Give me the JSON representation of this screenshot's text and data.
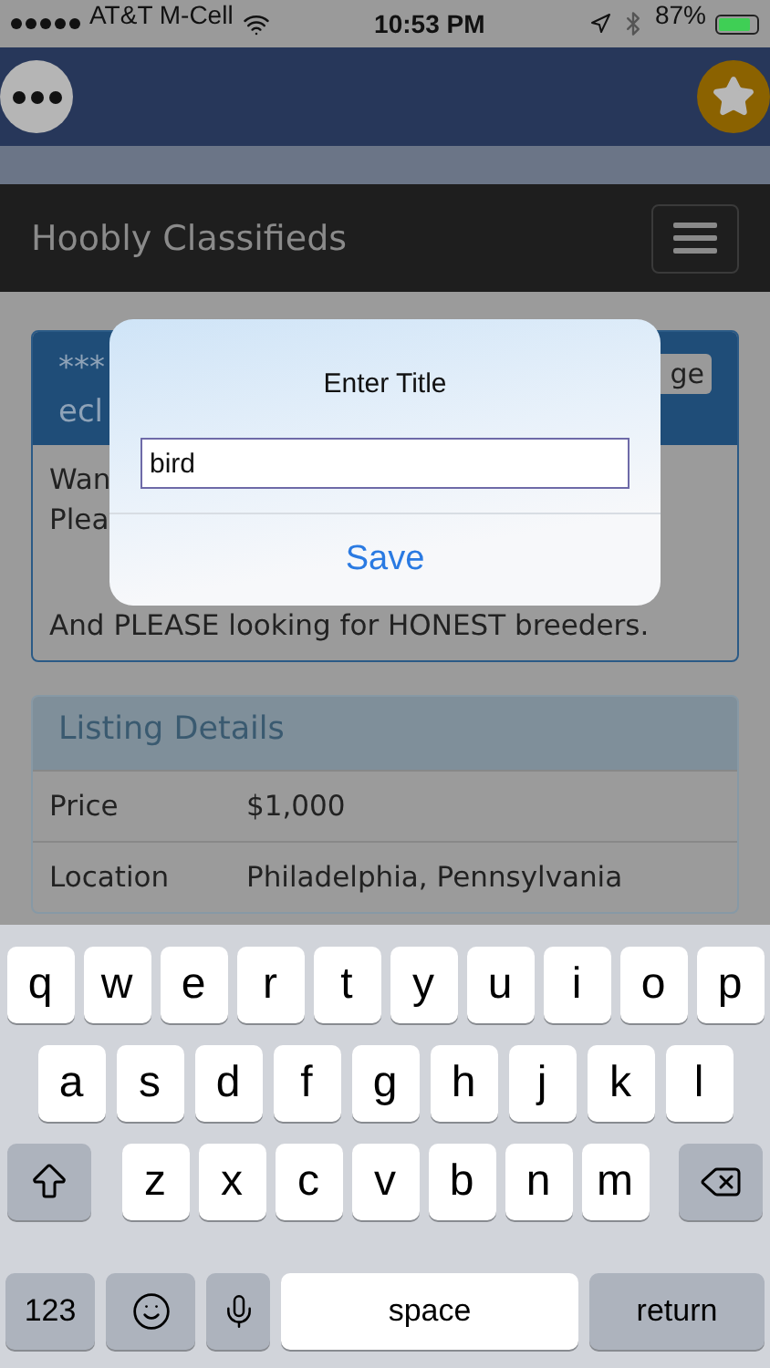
{
  "status_bar": {
    "carrier": "AT&T M-Cell",
    "time": "10:53 PM",
    "battery": "87%"
  },
  "navbar": {
    "title": "Hoobly Classifieds"
  },
  "listing": {
    "title_lines": [
      "***",
      "ecl"
    ],
    "button": "ge",
    "body_lines": [
      "Wan",
      "Plea"
    ],
    "body_last": "And PLEASE looking for HONEST breeders."
  },
  "details": {
    "title": "Listing Details",
    "rows": [
      {
        "label": "Price",
        "value": "$1,000"
      },
      {
        "label": "Location",
        "value": "Philadelphia, Pennsylvania"
      }
    ]
  },
  "dialog": {
    "title": "Enter Title",
    "value": "bird",
    "button": "Save"
  },
  "keyboard": {
    "rows": [
      [
        "q",
        "w",
        "e",
        "r",
        "t",
        "y",
        "u",
        "i",
        "o",
        "p"
      ],
      [
        "a",
        "s",
        "d",
        "f",
        "g",
        "h",
        "j",
        "k",
        "l"
      ],
      [
        "z",
        "x",
        "c",
        "v",
        "b",
        "n",
        "m"
      ]
    ],
    "numbers_key": "123",
    "space_key": "space",
    "return_key": "return"
  }
}
